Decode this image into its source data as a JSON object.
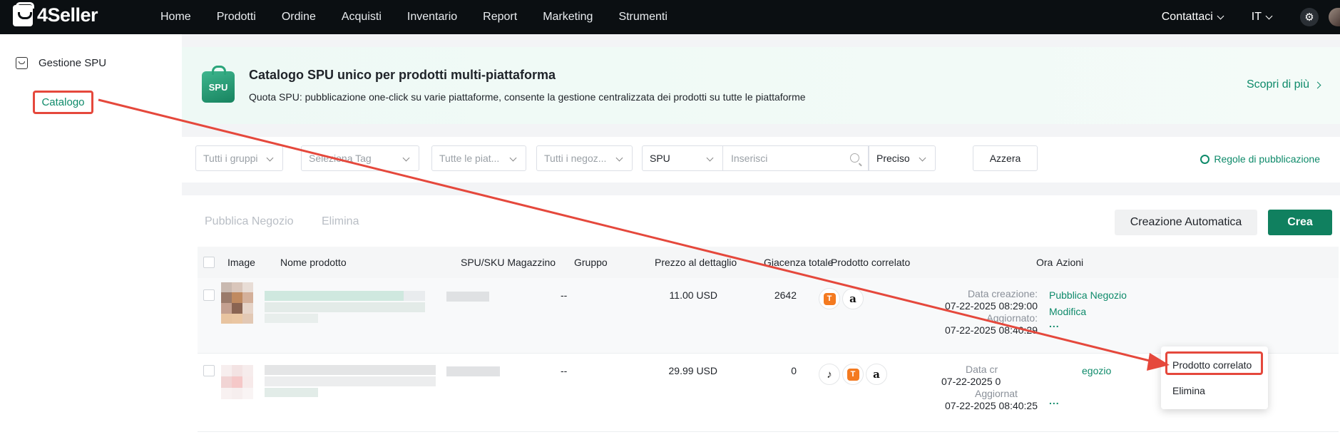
{
  "app": {
    "brand": "4Seller"
  },
  "nav": {
    "items": [
      "Home",
      "Prodotti",
      "Ordine",
      "Acquisti",
      "Inventario",
      "Report",
      "Marketing",
      "Strumenti"
    ],
    "contact": "Contattaci",
    "language": "IT"
  },
  "sidebar": {
    "group": "Gestione SPU",
    "item": "Catalogo"
  },
  "banner": {
    "icon_text": "SPU",
    "title": "Catalogo SPU unico per prodotti multi-piattaforma",
    "description": "Quota SPU: pubblicazione one-click su varie piattaforme, consente la gestione centralizzata dei prodotti su tutte le piattaforme",
    "link": "Scopri di più"
  },
  "filters": {
    "groups": "Tutti i gruppi",
    "tag": "Seleziona Tag",
    "platforms": "Tutte le piat...",
    "shops": "Tutti i negoz...",
    "search_type": "SPU",
    "search_placeholder": "Inserisci",
    "match": "Preciso",
    "reset": "Azzera",
    "rules": "Regole di pubblicazione"
  },
  "toolbar": {
    "publish": "Pubblica Negozio",
    "delete": "Elimina",
    "auto_create": "Creazione Automatica",
    "create": "Crea"
  },
  "table": {
    "columns": [
      "Image",
      "Nome prodotto",
      "SPU/SKU Magazzino",
      "Gruppo",
      "Prezzo al dettaglio",
      "Giacenza totale",
      "Prodotto correlato",
      "Ora",
      "Azioni"
    ],
    "rows": [
      {
        "group": "--",
        "price": "11.00 USD",
        "stock": "2642",
        "platforms": [
          "temu-icon",
          "amazon-icon"
        ],
        "created_label": "Data creazione:",
        "created": "07-22-2025 08:29:00",
        "updated_label": "Aggiornato:",
        "updated": "07-22-2025 08:40:29",
        "actions": [
          "Pubblica Negozio",
          "Modifica",
          "..."
        ]
      },
      {
        "group": "--",
        "price": "29.99 USD",
        "stock": "0",
        "platforms": [
          "tiktok-icon",
          "temu-icon",
          "amazon-icon"
        ],
        "created_label": "Data cr",
        "created": "07-22-2025 0",
        "updated_label": "Aggiornat",
        "updated": "07-22-2025 08:40:25",
        "actions": [
          "egozio",
          "..."
        ]
      }
    ]
  },
  "dropdown": {
    "items": [
      "Prodotto correlato",
      "Elimina"
    ]
  },
  "colors": {
    "accent": "#10805f",
    "link": "#0e8a6a",
    "highlight": "#e5483c",
    "topbar": "#0b0f12"
  }
}
